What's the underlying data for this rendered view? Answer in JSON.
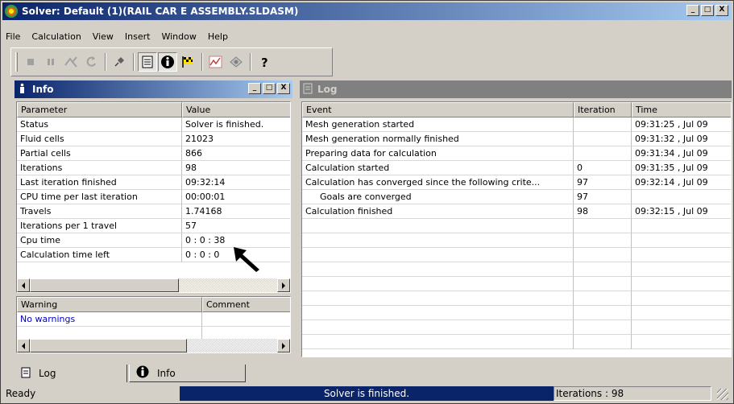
{
  "window": {
    "title": "Solver: Default (1)(RAIL CAR E ASSEMBLY.SLDASM)",
    "controls": [
      "_",
      "□",
      "X"
    ]
  },
  "menu": [
    "File",
    "Calculation",
    "View",
    "Insert",
    "Window",
    "Help"
  ],
  "toolbar": {
    "icons": [
      "stop-icon",
      "pause-icon",
      "run-icon",
      "refresh-icon",
      "pin-icon",
      "log-icon",
      "info-icon",
      "goals-icon",
      "plot-icon",
      "preview-icon",
      "help-icon"
    ]
  },
  "info": {
    "title": "Info",
    "columns": [
      "Parameter",
      "Value"
    ],
    "rows": [
      [
        "Status",
        "Solver is finished."
      ],
      [
        "Fluid cells",
        "21023"
      ],
      [
        "Partial cells",
        "866"
      ],
      [
        "Iterations",
        "98"
      ],
      [
        "Last iteration finished",
        "09:32:14"
      ],
      [
        "CPU time per last iteration",
        "00:00:01"
      ],
      [
        "Travels",
        "1.74168"
      ],
      [
        "Iterations per 1 travel",
        "57"
      ],
      [
        "Cpu time",
        "0 : 0 : 38"
      ],
      [
        "Calculation time left",
        "0 : 0 : 0"
      ]
    ],
    "warning_columns": [
      "Warning",
      "Comment"
    ],
    "warnings": [
      [
        "No warnings",
        ""
      ]
    ],
    "warning_color": "#0000cc"
  },
  "log": {
    "title": "Log",
    "columns": [
      "Event",
      "Iteration",
      "Time"
    ],
    "rows": [
      [
        "Mesh generation started",
        "",
        "09:31:25 , Jul 09"
      ],
      [
        "Mesh generation normally finished",
        "",
        "09:31:32 , Jul 09"
      ],
      [
        "Preparing data for calculation",
        "",
        "09:31:34 , Jul 09"
      ],
      [
        "Calculation started",
        "0",
        "09:31:35 , Jul 09"
      ],
      [
        "Calculation has converged since the following crite...",
        "97",
        "09:32:14 , Jul 09"
      ],
      [
        "    Goals are converged",
        "97",
        ""
      ],
      [
        "Calculation finished",
        "98",
        "09:32:15 , Jul 09"
      ]
    ]
  },
  "tabs": [
    {
      "label": "Log",
      "icon": "log-icon"
    },
    {
      "label": "Info",
      "icon": "info-icon"
    }
  ],
  "status": {
    "ready": "Ready",
    "progress_text": "Solver is finished.",
    "iterations": "Iterations : 98"
  }
}
